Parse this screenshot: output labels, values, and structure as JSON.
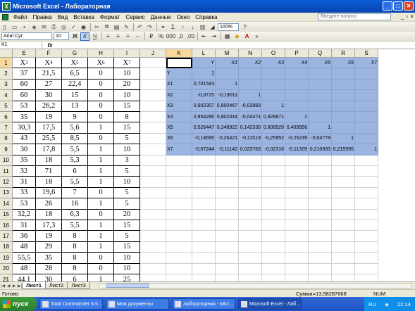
{
  "window": {
    "title": "Microsoft Excel - Лабораторная"
  },
  "menu": {
    "items": [
      "Файл",
      "Правка",
      "Вид",
      "Вставка",
      "Формат",
      "Сервис",
      "Данные",
      "Окно",
      "Справка"
    ],
    "ask_placeholder": "Введите вопрос"
  },
  "toolbar": {
    "zoom": "100%",
    "font": "Arial Cyr",
    "font_size": "10"
  },
  "formula_bar": {
    "name_box": "K1",
    "fx": "fx",
    "content": ""
  },
  "columns": [
    "E",
    "F",
    "G",
    "H",
    "I",
    "J",
    "K",
    "L",
    "M",
    "N",
    "O",
    "P",
    "Q",
    "R",
    "S"
  ],
  "rows": [
    "1",
    "2",
    "3",
    "4",
    "5",
    "6",
    "7",
    "8",
    "9",
    "10",
    "11",
    "12",
    "13",
    "14",
    "15",
    "16",
    "17",
    "18",
    "19",
    "20",
    "21",
    "22"
  ],
  "left_table": {
    "headers": [
      {
        "base": "X",
        "sub": "3"
      },
      {
        "base": "X",
        "sub": "4"
      },
      {
        "base": "X",
        "sub": "5"
      },
      {
        "base": "X",
        "sub": "6"
      },
      {
        "base": "X",
        "sub": "7"
      }
    ],
    "data": [
      [
        "37",
        "21,5",
        "6,5",
        "0",
        "10"
      ],
      [
        "60",
        "27",
        "22,4",
        "0",
        "20"
      ],
      [
        "60",
        "30",
        "15",
        "0",
        "10"
      ],
      [
        "53",
        "26,2",
        "13",
        "0",
        "15"
      ],
      [
        "35",
        "19",
        "9",
        "0",
        "8"
      ],
      [
        "30,3",
        "17,5",
        "5,6",
        "1",
        "15"
      ],
      [
        "43",
        "25,5",
        "8,5",
        "0",
        "5"
      ],
      [
        "30",
        "17,8",
        "5,5",
        "1",
        "10"
      ],
      [
        "35",
        "18",
        "5,3",
        "1",
        "3"
      ],
      [
        "32",
        "71",
        "6",
        "1",
        "5"
      ],
      [
        "31",
        "18",
        "5,5",
        "1",
        "10"
      ],
      [
        "33",
        "19,6",
        "7",
        "0",
        "5"
      ],
      [
        "53",
        "26",
        "16",
        "1",
        "5"
      ],
      [
        "32,2",
        "18",
        "6,3",
        "0",
        "20"
      ],
      [
        "31",
        "17,3",
        "5,5",
        "1",
        "15"
      ],
      [
        "36",
        "19",
        "8",
        "1",
        "5"
      ],
      [
        "48",
        "29",
        "8",
        "1",
        "15"
      ],
      [
        "55,5",
        "35",
        "8",
        "0",
        "10"
      ],
      [
        "48",
        "28",
        "8",
        "0",
        "10"
      ],
      [
        "44,1",
        "30",
        "6",
        "1",
        "25"
      ],
      [
        "39",
        "51",
        "13",
        "0",
        "10"
      ]
    ]
  },
  "corr_matrix": {
    "col_labels": [
      "Y",
      "X1",
      "X2",
      "X3",
      "X4",
      "X5",
      "X6",
      "X7"
    ],
    "row_labels": [
      "Y",
      "X1",
      "X2",
      "X3",
      "X4",
      "X5",
      "X6",
      "X7"
    ],
    "values": [
      [
        "1",
        "",
        "",
        "",
        "",
        "",
        "",
        ""
      ],
      [
        "0,701543",
        "1",
        "",
        "",
        "",
        "",
        "",
        ""
      ],
      [
        "-0,0725",
        "-0,19011",
        "1",
        "",
        "",
        "",
        "",
        ""
      ],
      [
        "0,902307",
        "0,800467",
        "-0,03983",
        "1",
        "",
        "",
        "",
        ""
      ],
      [
        "0,854296",
        "0,802044",
        "-0,04474",
        "0,928671",
        "1",
        "",
        "",
        ""
      ],
      [
        "0,526447",
        "0,248922",
        "0,142335",
        "0,608929",
        "0,409956",
        "1",
        "",
        ""
      ],
      [
        "-0,18695",
        "-0,26421",
        "-0,11519",
        "-0,25952",
        "-0,25239",
        "-0,04779",
        "1",
        ""
      ],
      [
        "-0,07244",
        "-0,11142",
        "0,023763",
        "-0,02316",
        "-0,11309",
        "0,210933",
        "0,215595",
        "1"
      ]
    ]
  },
  "sheet_tabs": [
    "Лист1",
    "Лист2",
    "Лист3"
  ],
  "status": {
    "ready": "Готово",
    "sum": "Сумма=13,58287668",
    "num": "NUM"
  },
  "taskbar": {
    "start": "пуск",
    "tasks": [
      "Total Commander 6.5...",
      "Мои документы",
      "лабораторная - Micr...",
      "Microsoft Excel - Лаб..."
    ],
    "lang": "RU",
    "time": "22:14"
  }
}
